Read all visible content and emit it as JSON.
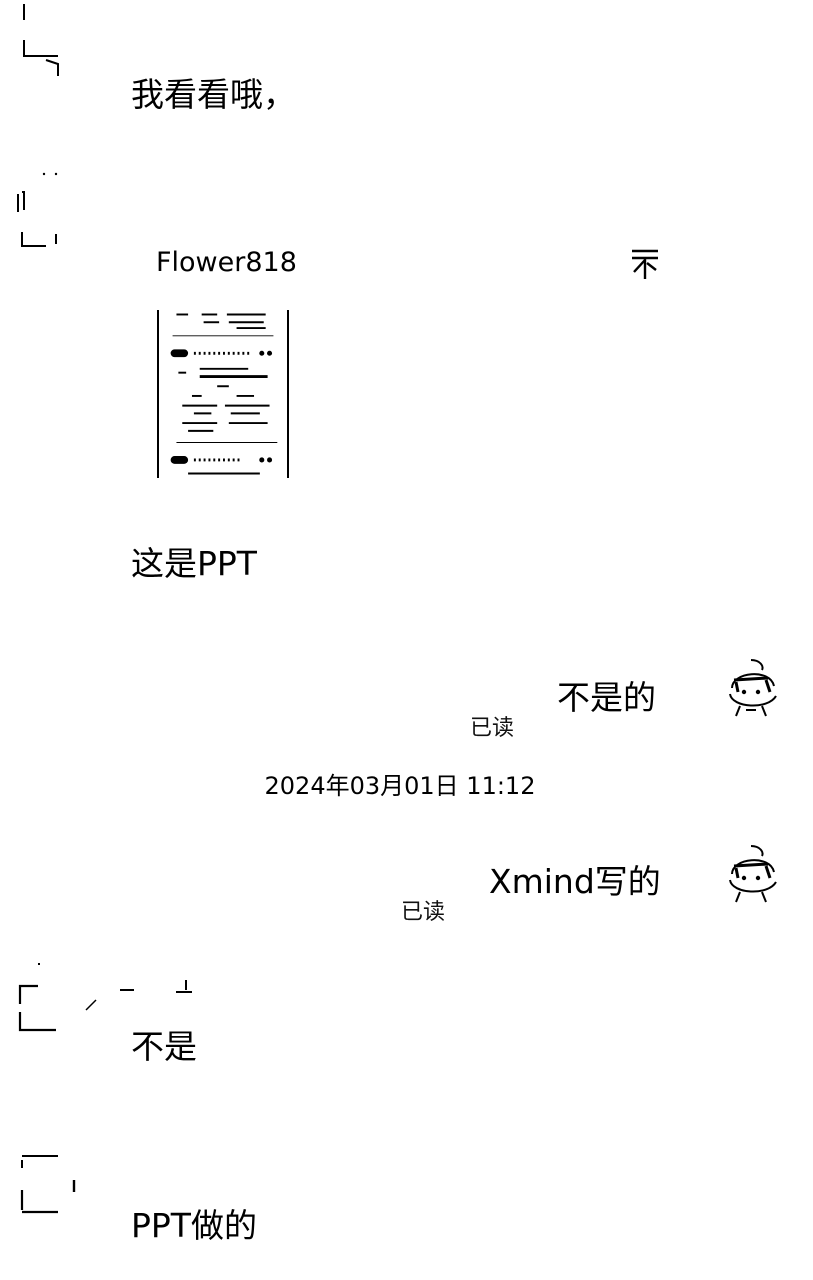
{
  "messages": [
    {
      "side": "left",
      "text": "我看看哦，"
    },
    {
      "side": "left",
      "card": {
        "sender": "Flower818",
        "pin_icon": "pin-top-icon",
        "thumbnail": "document-thumbnail"
      }
    },
    {
      "side": "left",
      "text": "这是PPT"
    },
    {
      "side": "right",
      "text": "不是的",
      "read": "已读"
    },
    {
      "side": "right",
      "text": "Xmind写的",
      "read": "已读"
    },
    {
      "side": "left",
      "text": "不是"
    },
    {
      "side": "left",
      "text": "PPT做的"
    }
  ],
  "timestamp": "2024年03月01日 11:12",
  "icons": {
    "my_avatar": "cartoon-avatar-icon",
    "other_avatar": "avatar-placeholder-icon"
  }
}
